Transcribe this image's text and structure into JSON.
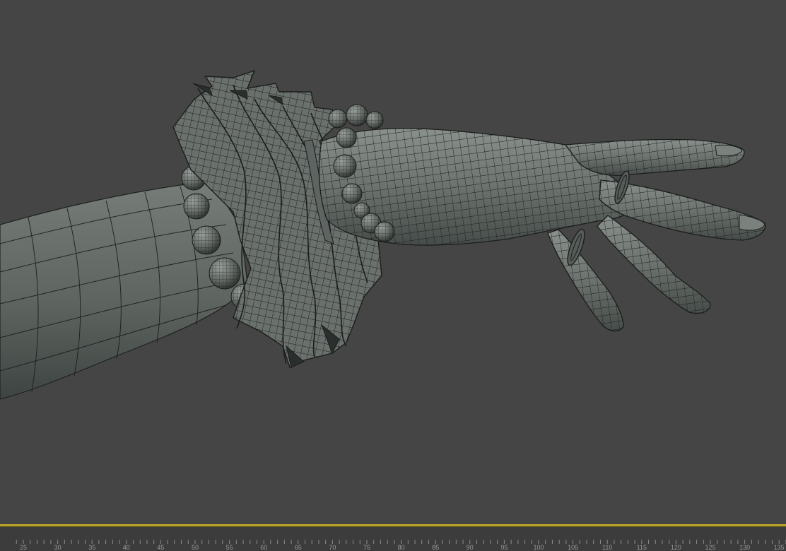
{
  "viewport": {
    "background": "#454545",
    "model_color": "#6b716c",
    "wire_color": "#1b1d1c",
    "objects": [
      "arm",
      "ruffle-cuff",
      "bead-bracelet",
      "hand",
      "ring-ring-finger",
      "ring-middle-finger"
    ]
  },
  "timeline": {
    "track_color": "#b8a22a",
    "ticks": [
      "25",
      "30",
      "35",
      "40",
      "45",
      "50",
      "55",
      "60",
      "65",
      "70",
      "75",
      "80",
      "85",
      "90",
      "95",
      "100",
      "105",
      "110",
      "115",
      "120",
      "125",
      "130",
      "135"
    ]
  }
}
